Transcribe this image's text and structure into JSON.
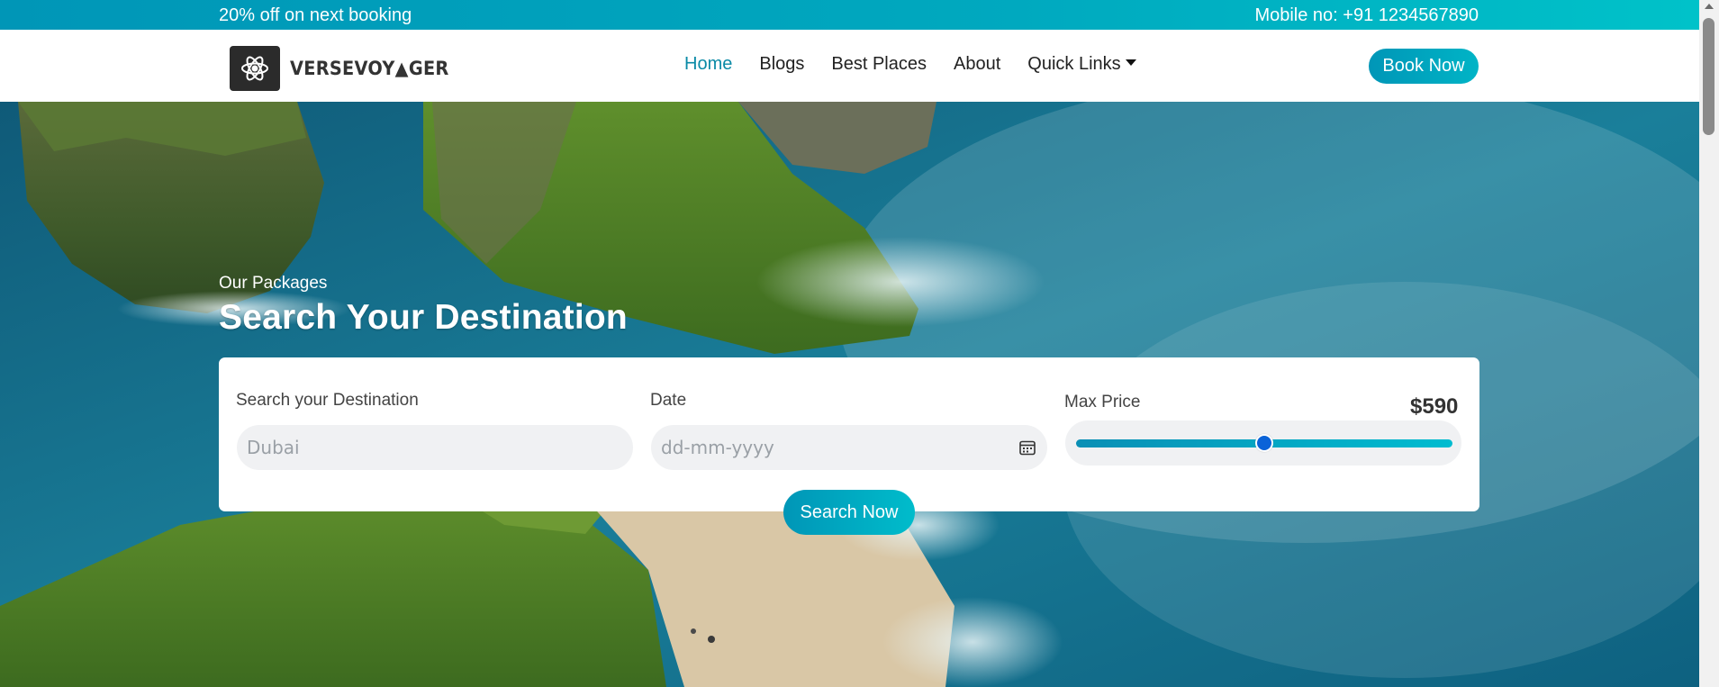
{
  "topbar": {
    "promo": "20% off on next booking",
    "mobile": "Mobile no: +91 1234567890"
  },
  "brand": {
    "name": "VERSEVOY▲GER",
    "logo_icon": "flower-icon"
  },
  "nav": {
    "items": [
      {
        "label": "Home",
        "active": true
      },
      {
        "label": "Blogs",
        "active": false
      },
      {
        "label": "Best Places",
        "active": false
      },
      {
        "label": "About",
        "active": false
      },
      {
        "label": "Quick Links",
        "active": false,
        "dropdown": true
      }
    ],
    "book_label": "Book Now"
  },
  "hero": {
    "subtitle": "Our Packages",
    "title": "Search Your Destination"
  },
  "search": {
    "destination_label": "Search your Destination",
    "destination_placeholder": "Dubai",
    "date_label": "Date",
    "date_placeholder": "dd-mm-yyyy",
    "price_label": "Max Price",
    "price_value": "$590",
    "price_fraction": 0.5,
    "button_label": "Search Now"
  },
  "colors": {
    "accent": "#00a9bf",
    "active_nav": "#0a8aa6",
    "slider_thumb": "#0b63d8"
  }
}
